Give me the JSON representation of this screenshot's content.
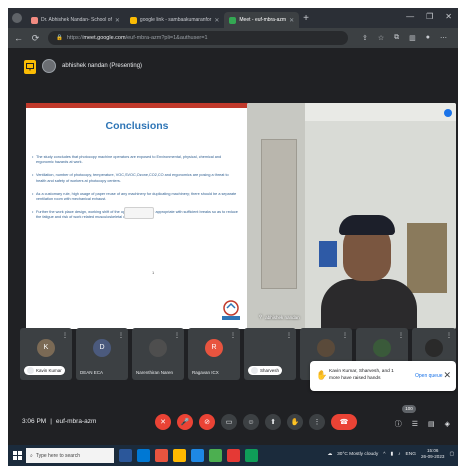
{
  "browser": {
    "tabs": [
      {
        "label": "Dr. Abhishek Nandan- School of",
        "active": false,
        "favicon_color": "#f28b82"
      },
      {
        "label": "google link - sambaakumaranfor",
        "active": false,
        "favicon_color": "#fbbc04"
      },
      {
        "label": "Meet - euf-mbra-azm",
        "active": true,
        "favicon_color": "#34a853"
      }
    ],
    "new_tab": "+",
    "url_prefix": "https://",
    "url_host": "meet.google.com",
    "url_path": "/euf-mbra-azm?pli=1&authuser=1"
  },
  "meet": {
    "presenter_label": "abhishek nandan (Presenting)",
    "meeting_time": "3:06 PM",
    "separator": "|",
    "meeting_code": "euf-mbra-azm",
    "participant_count": "100"
  },
  "slide": {
    "title": "Conclusions",
    "bullets": [
      "The study concludes that photocopy machine operators are exposed to Environmental, physical, chemical and ergonomic hazards at work.",
      "Ventilation, number of photocopy, temperature, VOC,SVOC,Ozone,CO2,CO and ergonomics are posing a threat to health and safety of workers at photocopy centers.",
      "As a customary rule, high usage of paper reuse of any machinery for duplicating machinery; there should be a separate ventilation room with mechanical exhaust.",
      "Further the work place design, working shift of the operators should be appropriate with sufficient breaks so as to reduce the fatigue and risk of work related musculoskeletal discomfort."
    ],
    "page_marker": "1",
    "logo_text": "UPES"
  },
  "camera": {
    "name": "abhishek nandan"
  },
  "participants": [
    {
      "initial": "K",
      "name": "Kavin Kumar",
      "color": "#7b6a55",
      "pinned": true
    },
    {
      "initial": "D",
      "name": "DEAN ECA",
      "color": "#4b5a7d",
      "pinned": false
    },
    {
      "initial": "",
      "name": "Narenthiran Naren",
      "color": "#4e4e4e",
      "pinned": false
    },
    {
      "initial": "R",
      "name": "Ragavan ICX",
      "color": "#e8543f",
      "pinned": false
    },
    {
      "initial": "",
      "name": "Sharvesh",
      "color": "#3c4043",
      "pinned": true
    },
    {
      "initial": "",
      "name": "",
      "color": "#5a4a3a",
      "pinned": false
    },
    {
      "initial": "",
      "name": "",
      "color": "#3a5a3a",
      "pinned": false
    },
    {
      "initial": "",
      "name": "",
      "color": "#2a2a2a",
      "pinned": false
    }
  ],
  "raised_hands": {
    "text": "Kavin Kumar, Sharvesh, and 1 more have raised hands",
    "action": "Open queue",
    "close": "✕"
  },
  "controls": [
    "mic-off",
    "cc",
    "camera-off",
    "present",
    "emoji",
    "hand",
    "more",
    "end-call"
  ],
  "taskbar": {
    "search_placeholder": "Type here to search",
    "weather": "30°C Mostly cloudy",
    "language": "ENG",
    "time": "15:06",
    "date": "26-09-2023",
    "apps": [
      "#2b579a",
      "#0078d4",
      "#e8543f",
      "#ffb900",
      "#1e88e5",
      "#4caf50",
      "#e53935",
      "#0f9d58"
    ]
  }
}
